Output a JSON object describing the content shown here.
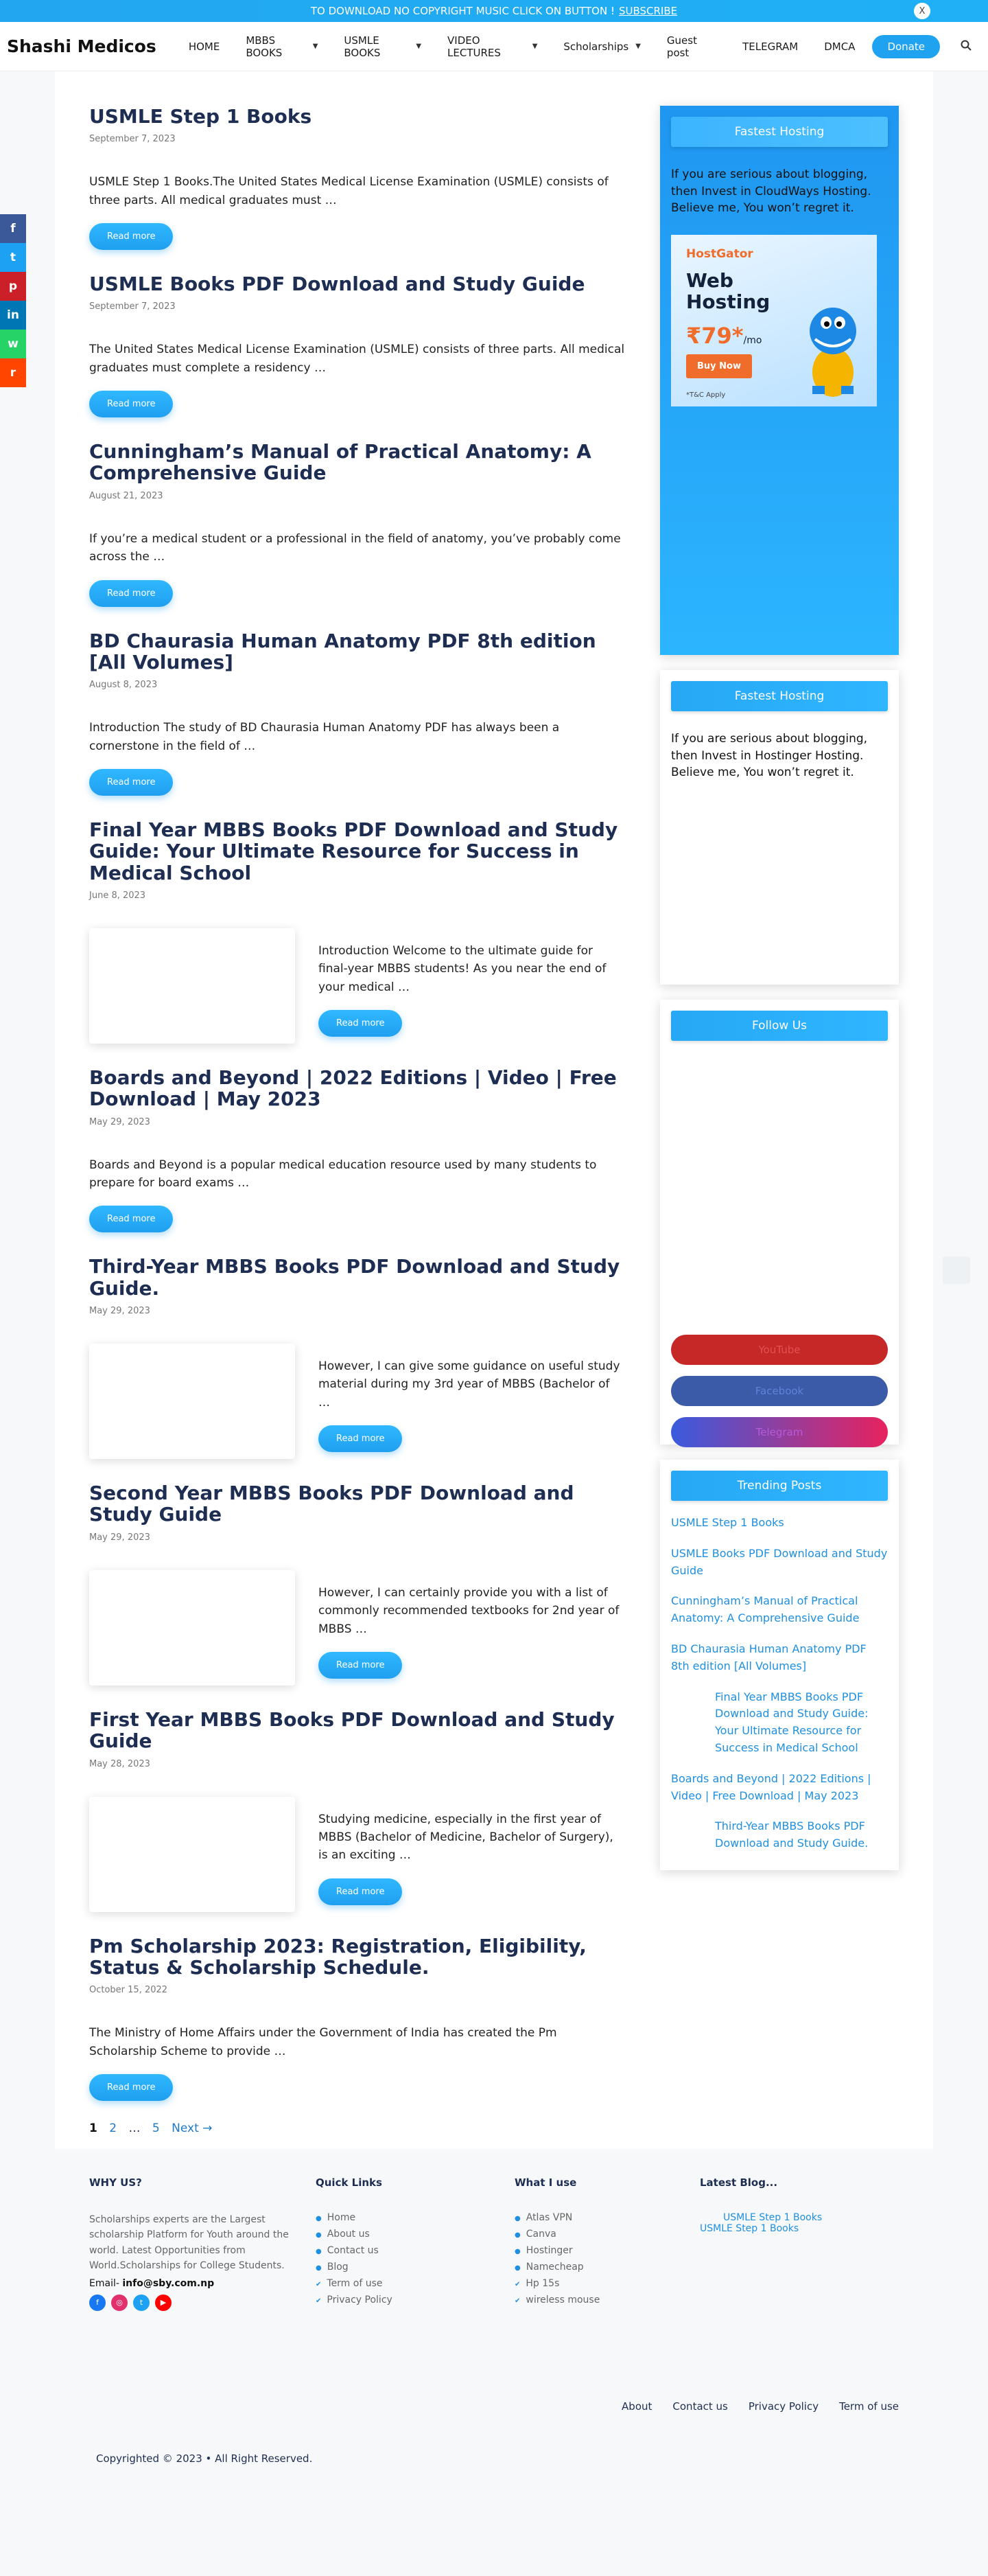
{
  "topbar": {
    "text": "TO DOWNLOAD NO COPYRIGHT MUSIC CLICK ON BUTTON !",
    "link": "SUBSCRIBE",
    "close": "X"
  },
  "header": {
    "brand": "Shashi Medicos",
    "nav": {
      "home": "HOME",
      "mbbs": "MBBS BOOKS",
      "usmle": "USMLE BOOKS",
      "video": "VIDEO LECTURES",
      "scholar": "Scholarships",
      "guest": "Guest post",
      "telegram": "TELEGRAM",
      "dmca": "DMCA"
    },
    "donate": "Donate"
  },
  "posts": [
    {
      "title": "USMLE Step 1 Books",
      "date": "September 7, 2023",
      "excerpt": "USMLE Step 1 Books.The United States Medical License Examination (USMLE) consists of three parts. All medical graduates must …",
      "readmore": "Read more"
    },
    {
      "title": "USMLE Books PDF Download and Study Guide",
      "date": "September 7, 2023",
      "excerpt": "The United States Medical License Examination (USMLE) consists of three parts. All medical graduates must complete a residency …",
      "readmore": "Read more"
    },
    {
      "title": "Cunningham’s Manual of Practical Anatomy: A Comprehensive Guide",
      "date": "August 21, 2023",
      "excerpt": "If you’re a medical student or a professional in the field of anatomy, you’ve probably come across the …",
      "readmore": "Read more"
    },
    {
      "title": "BD Chaurasia Human Anatomy PDF 8th edition [All Volumes]",
      "date": "August 8, 2023",
      "excerpt": "Introduction The study of BD Chaurasia Human Anatomy PDF has always been a cornerstone in the field of …",
      "readmore": "Read more"
    },
    {
      "title": "Final Year MBBS Books PDF Download and Study Guide: Your Ultimate Resource for Success in Medical School",
      "date": "June 8, 2023",
      "excerpt": "Introduction Welcome to the ultimate guide for final-year MBBS students! As you near the end of your medical …",
      "readmore": "Read more"
    },
    {
      "title": "Boards and Beyond | 2022 Editions | Video | Free Download | May 2023",
      "date": "May 29, 2023",
      "excerpt": "Boards and Beyond is a popular medical education resource used by many students to prepare for board exams …",
      "readmore": "Read more"
    },
    {
      "title": "Third-Year MBBS Books PDF Download and Study Guide.",
      "date": "May 29, 2023",
      "excerpt": "However, I can give some guidance on useful study material during my 3rd year of MBBS (Bachelor of …",
      "readmore": "Read more"
    },
    {
      "title": "Second Year MBBS Books PDF Download and Study Guide",
      "date": "May 29, 2023",
      "excerpt": "However, I can certainly provide you with a list of commonly recommended textbooks for 2nd year of MBBS …",
      "readmore": "Read more"
    },
    {
      "title": "First Year MBBS Books PDF Download and Study Guide",
      "date": "May 28, 2023",
      "excerpt": "Studying medicine, especially in the first year of MBBS (Bachelor of Medicine, Bachelor of Surgery), is an exciting …",
      "readmore": "Read more"
    },
    {
      "title": "Pm Scholarship 2023: Registration, Eligibility, Status & Scholarship Schedule.",
      "date": "October 15, 2022",
      "excerpt": "The Ministry of Home Affairs under the Government of India has created the Pm Scholarship Scheme to provide …",
      "readmore": "Read more"
    }
  ],
  "pagination": {
    "current": "1",
    "p2": "2",
    "dots": "…",
    "p5": "5",
    "next": "Next →"
  },
  "sidebar": {
    "hosting1": {
      "title": "Fastest Hosting",
      "text": "If you are serious about blogging, then Invest in CloudWays Hosting. Believe me, You won’t regret it.",
      "ad": {
        "brand": "HostGator",
        "headline1": "Web",
        "headline2": "Hosting",
        "price": "₹79*",
        "per": "/mo",
        "button": "Buy Now",
        "note": "*T&C Apply"
      }
    },
    "hosting2": {
      "title": "Fastest Hosting",
      "text": "If you are serious about blogging, then Invest in Hostinger Hosting. Believe me, You won’t regret it."
    },
    "follow": {
      "title": "Follow Us",
      "youtube": "YouTube",
      "facebook": "Facebook",
      "telegram": "Telegram"
    },
    "trending": {
      "title": "Trending Posts",
      "items": [
        "USMLE Step 1 Books",
        "USMLE Books PDF Download and Study Guide",
        "Cunningham’s Manual of Practical Anatomy: A Comprehensive Guide",
        "BD Chaurasia Human Anatomy PDF 8th edition [All Volumes]",
        "Final Year MBBS Books PDF Download and Study Guide: Your Ultimate Resource for Success in Medical School",
        "Boards and Beyond | 2022 Editions | Video | Free Download | May 2023",
        "Third-Year MBBS Books PDF Download and Study Guide."
      ]
    }
  },
  "share": {
    "facebook": "f",
    "twitter": "t",
    "pinterest": "p",
    "linkedin": "in",
    "whatsapp": "w",
    "reddit": "r"
  },
  "footer": {
    "why": {
      "title": "WHY US?",
      "text": "Scholarships experts are the Largest scholarship Platform for Youth around the world. Latest Opportunities from World.Scholarships for College Students.",
      "email_label": "Email-",
      "email": "info@sby.com.np"
    },
    "quick": {
      "title": "Quick Links",
      "items": [
        "Home",
        "About us",
        "Contact us",
        "Blog",
        "Term of use",
        "Privacy Policy"
      ]
    },
    "use": {
      "title": "What I use",
      "items": [
        "Atlas VPN",
        "Canva",
        "Hostinger",
        "Namecheap",
        "Hp 15s",
        "wireless mouse"
      ]
    },
    "blog": {
      "title": "Latest Blog...",
      "items": [
        "USMLE Step 1 Books",
        "USMLE Step 1 Books"
      ]
    },
    "bottom": {
      "about": "About",
      "contact": "Contact us",
      "privacy": "Privacy Policy",
      "term": "Term of use"
    },
    "copyright": "Copyrighted © 2023 • All Right Reserved."
  }
}
